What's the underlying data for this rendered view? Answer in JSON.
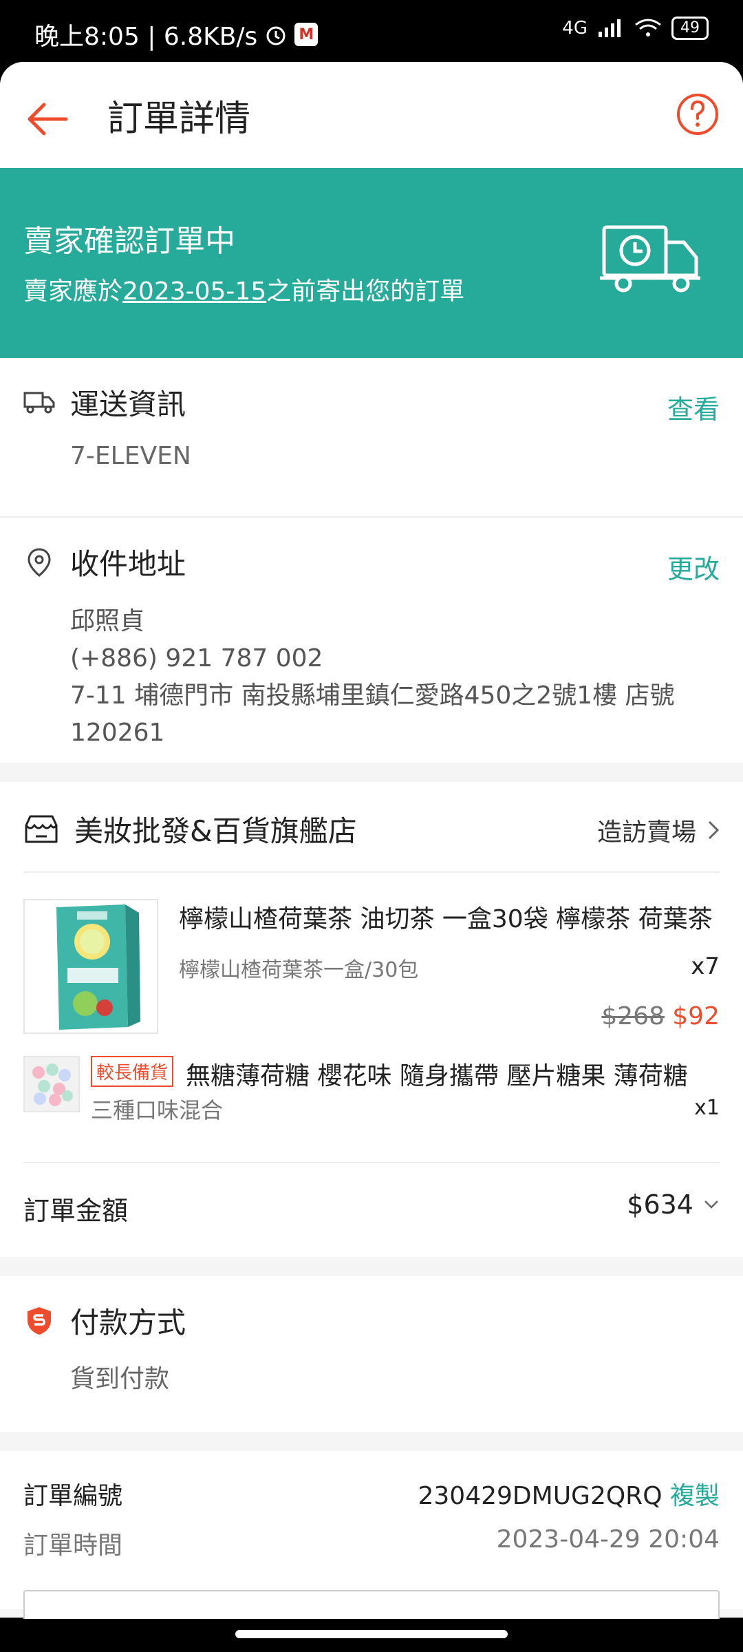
{
  "status_bar": {
    "time": "晚上8:05 | 6.8KB/s",
    "network": "4G",
    "battery": "49"
  },
  "header": {
    "title": "訂單詳情"
  },
  "banner": {
    "title": "賣家確認訂單中",
    "subtitle_prefix": "賣家應於",
    "date": "2023-05-15",
    "subtitle_suffix": "之前寄出您的訂單"
  },
  "shipping": {
    "title": "運送資訊",
    "action": "查看",
    "carrier": "7-ELEVEN"
  },
  "address": {
    "title": "收件地址",
    "action": "更改",
    "name": "邱照貞",
    "phone": "(+886) 921 787 002",
    "line": "7-11 埔德門市 南投縣埔里鎮仁愛路450之2號1樓 店號120261"
  },
  "shop": {
    "name": "美妝批發&百貨旗艦店",
    "visit": "造訪賣場"
  },
  "items": [
    {
      "name": "檸檬山楂荷葉茶 油切茶 一盒30袋 檸檬茶 荷葉茶",
      "variant": "檸檬山楂荷葉茶一盒/30包",
      "qty": "x7",
      "old_price": "$268",
      "price": "$92"
    },
    {
      "tag": "較長備貨",
      "name": "無糖薄荷糖 櫻花味 隨身攜帶 壓片糖果 薄荷糖",
      "variant": "三種口味混合",
      "qty": "x1"
    }
  ],
  "order_total": {
    "label": "訂單金額",
    "value": "$634"
  },
  "payment": {
    "title": "付款方式",
    "method": "貨到付款"
  },
  "order_info": {
    "id_label": "訂單編號",
    "id_value": "230429DMUG2QRQ",
    "copy": "複製",
    "time_label": "訂單時間",
    "time_value": "2023-04-29 20:04"
  },
  "colors": {
    "accent": "#ee4d2d",
    "teal": "#26aa99"
  }
}
